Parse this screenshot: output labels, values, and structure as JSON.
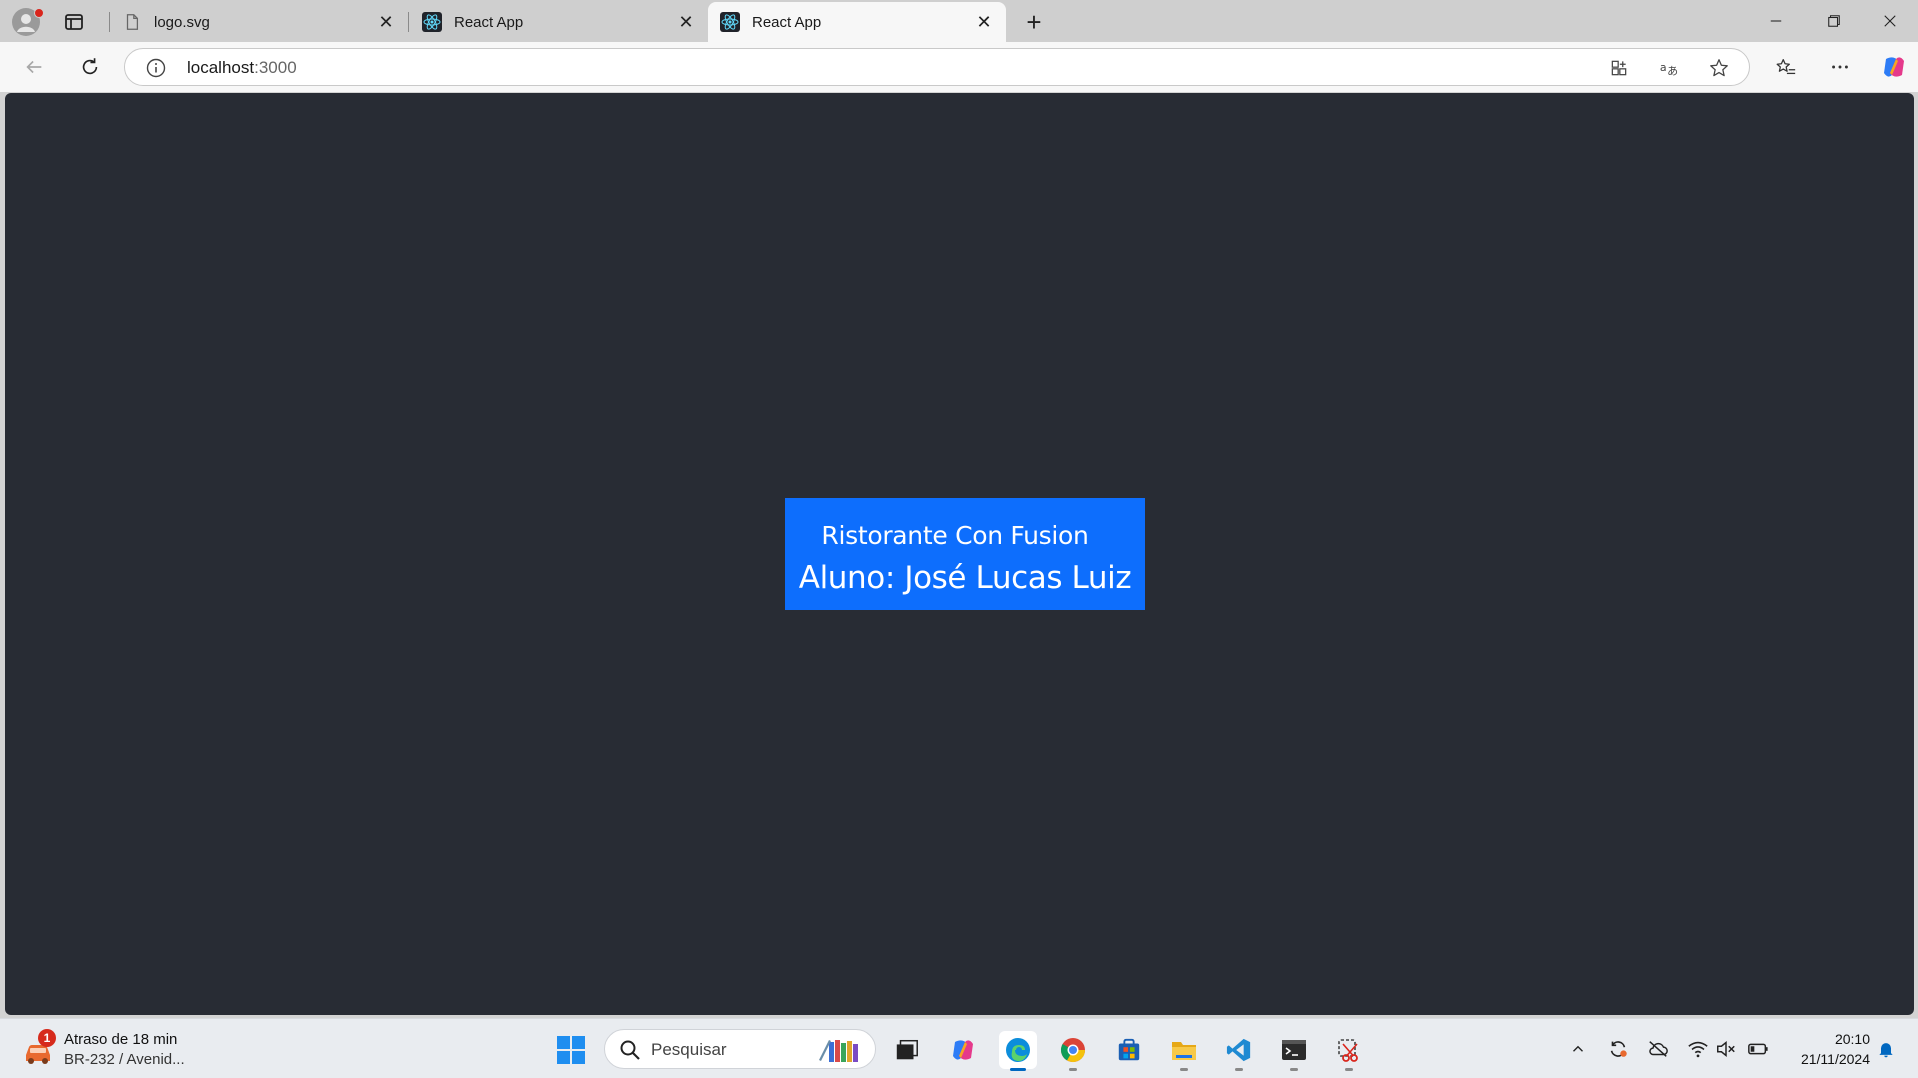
{
  "browser": {
    "tabs": [
      {
        "title": "logo.svg",
        "icon": "file-icon",
        "active": false
      },
      {
        "title": "React App",
        "icon": "react-logo-icon",
        "active": false
      },
      {
        "title": "React App",
        "icon": "react-logo-icon",
        "active": true
      }
    ],
    "close_glyph": "✕",
    "new_tab_glyph": "+",
    "address": {
      "host": "localhost",
      "port": ":3000"
    }
  },
  "page": {
    "brand": "Ristorante Con Fusion",
    "student": "Aluno: José Lucas Luiz",
    "background": "#282c34",
    "card_color": "#0d6efd"
  },
  "taskbar": {
    "weather": {
      "badge": "1",
      "line1": "Atraso de 18 min",
      "line2": "BR-232 / Avenid..."
    },
    "search_placeholder": "Pesquisar",
    "clock": {
      "time": "20:10",
      "date": "21/11/2024"
    }
  }
}
